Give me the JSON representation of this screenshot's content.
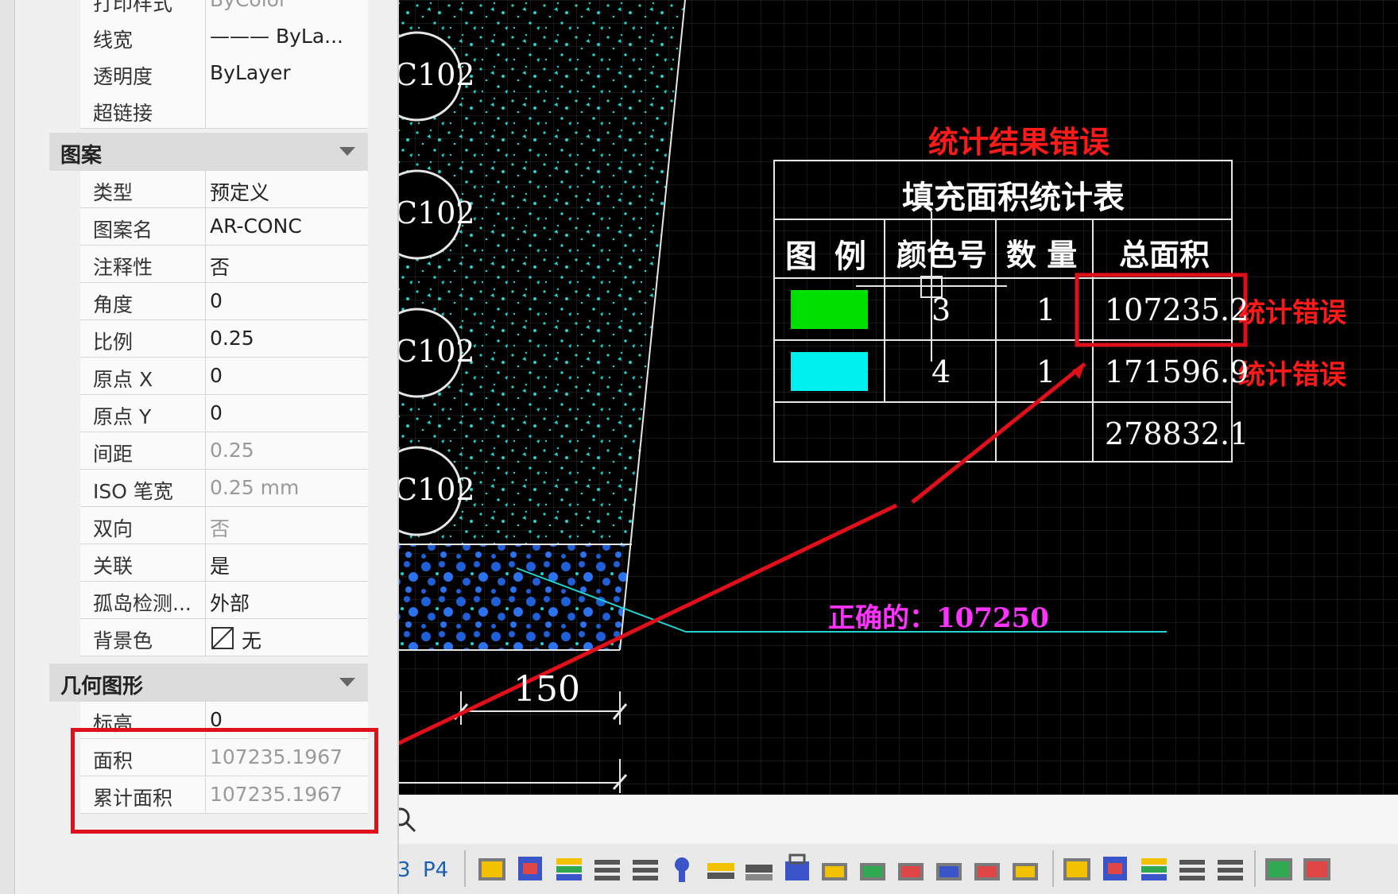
{
  "properties_palette": {
    "rows_top": [
      {
        "label": "打印样式",
        "value": "ByColor",
        "disabled": true
      },
      {
        "label": "线宽",
        "value": "——— ByLa...",
        "disabled": false
      },
      {
        "label": "透明度",
        "value": "ByLayer",
        "disabled": false
      },
      {
        "label": "超链接",
        "value": "",
        "disabled": false
      }
    ],
    "group_pattern": {
      "title": "图案",
      "rows": [
        {
          "label": "类型",
          "value": "预定义",
          "disabled": false
        },
        {
          "label": "图案名",
          "value": "AR-CONC",
          "disabled": false
        },
        {
          "label": "注释性",
          "value": "否",
          "disabled": false
        },
        {
          "label": "角度",
          "value": "0",
          "disabled": false
        },
        {
          "label": "比例",
          "value": "0.25",
          "disabled": false
        },
        {
          "label": "原点 X",
          "value": "0",
          "disabled": false
        },
        {
          "label": "原点 Y",
          "value": "0",
          "disabled": false
        },
        {
          "label": "间距",
          "value": "0.25",
          "disabled": true
        },
        {
          "label": "ISO 笔宽",
          "value": "0.25 mm",
          "disabled": true
        },
        {
          "label": "双向",
          "value": "否",
          "disabled": true
        },
        {
          "label": "关联",
          "value": "是",
          "disabled": false
        },
        {
          "label": "孤岛检测...",
          "value": "外部",
          "disabled": false
        },
        {
          "label": "背景色",
          "value": "无",
          "disabled": false
        }
      ]
    },
    "group_geometry": {
      "title": "几何图形",
      "rows": [
        {
          "label": "标高",
          "value": "0",
          "disabled": false
        },
        {
          "label": "面积",
          "value": "107235.1967",
          "disabled": true
        },
        {
          "label": "累计面积",
          "value": "107235.1967",
          "disabled": true
        }
      ]
    }
  },
  "drawing": {
    "circle_labels": [
      "C102",
      "C102",
      "C102",
      "C102"
    ],
    "dimension_text": "150",
    "annotation_title": "统计结果错误",
    "annotation_correct": "正确的：107250",
    "annotation_err1": "统计错误",
    "annotation_err2": "统计错误",
    "table": {
      "title": "填充面积统计表",
      "headers": [
        "图 例",
        "颜色号",
        "数 量",
        "总面积"
      ],
      "rows": [
        {
          "color": "#00e000",
          "color_no": "3",
          "count": "1",
          "area": "107235.2"
        },
        {
          "color": "#00f0f0",
          "color_no": "4",
          "count": "1",
          "area": "171596.9"
        }
      ],
      "total": "278832.1"
    }
  },
  "status": {
    "layout_tabs": [
      "3",
      "P4"
    ]
  },
  "colors": {
    "highlight": "#e0101a",
    "annotation_red": "#ff1a1a",
    "annotation_magenta": "#ff33ff",
    "cyan_hatch": "#22d3d3",
    "blue_hatch": "#1f5fd8"
  }
}
